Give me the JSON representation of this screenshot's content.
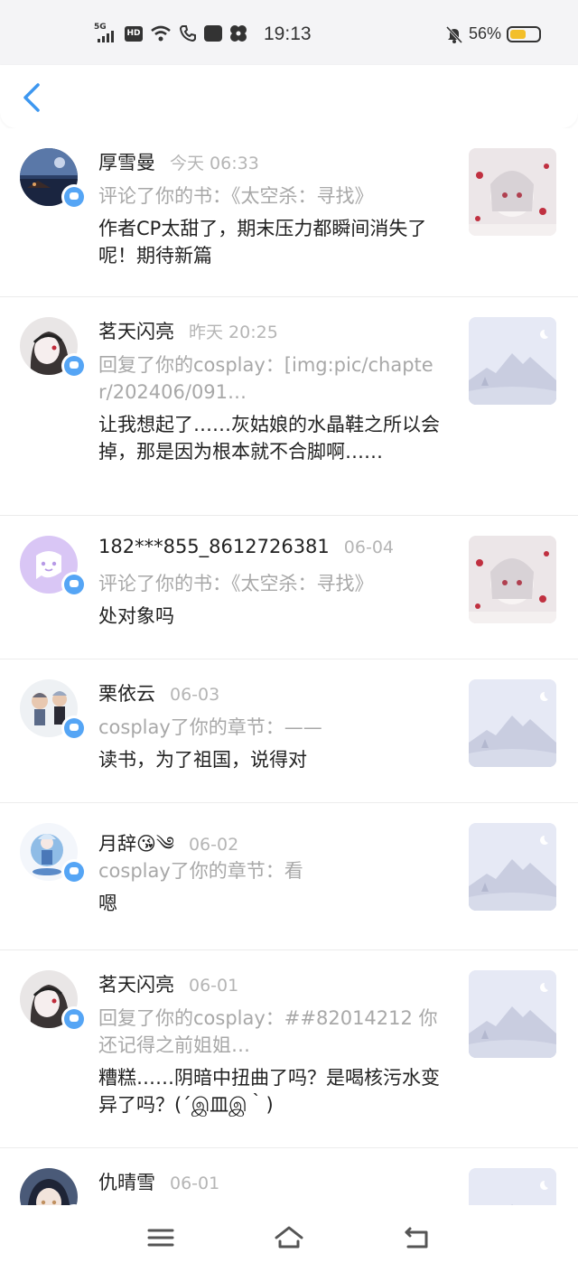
{
  "status_bar": {
    "network": "5G",
    "hd": "HD",
    "time": "19:13",
    "battery": "56%",
    "battery_level": 0.56,
    "battery_color": "#f3bf2a"
  },
  "colors": {
    "accent": "#3d97f0",
    "badge": "#55a5f5"
  },
  "notifications": [
    {
      "name": "厚雪曼",
      "date": "今天 06:33",
      "action": "评论了你的书：《太空杀：寻找》",
      "content": "作者CP太甜了，期末压力都瞬间消失了呢！期待新篇",
      "avatar": "night-sea-avatar",
      "thumb": "book-cover"
    },
    {
      "name": "茗天闪亮",
      "date": "昨天 20:25",
      "action": "回复了你的cosplay：[img:pic/chapter/202406/091…",
      "content": "让我想起了……灰姑娘的水晶鞋之所以会掉，那是因为根本就不合脚啊……",
      "avatar": "anime-girl-avatar",
      "thumb": "placeholder"
    },
    {
      "name": "182***855_8612726381",
      "date": "06-04",
      "action": "评论了你的书：《太空杀：寻找》",
      "content": "处对象吗",
      "avatar": "default-ghost-avatar",
      "thumb": "book-cover"
    },
    {
      "name": "栗依云",
      "date": "06-03",
      "action": "cosplay了你的章节：——",
      "content": "读书，为了祖国，说得对",
      "avatar": "chibi-avatar",
      "thumb": "placeholder"
    },
    {
      "name": "月辞😘༄",
      "date": "06-02",
      "action": "cosplay了你的章节：看",
      "content": "嗯",
      "avatar": "figure-avatar",
      "thumb": "placeholder"
    },
    {
      "name": "茗天闪亮",
      "date": "06-01",
      "action": "回复了你的cosplay：##82014212 你还记得之前姐姐…",
      "content": "糟糕……阴暗中扭曲了吗？是喝核污水变异了吗？(´இ皿இ｀)",
      "avatar": "anime-girl-avatar",
      "thumb": "placeholder"
    },
    {
      "name": "仇晴雪",
      "date": "06-01",
      "action": "",
      "content": "",
      "avatar": "dark-hair-avatar",
      "thumb": "placeholder"
    }
  ]
}
